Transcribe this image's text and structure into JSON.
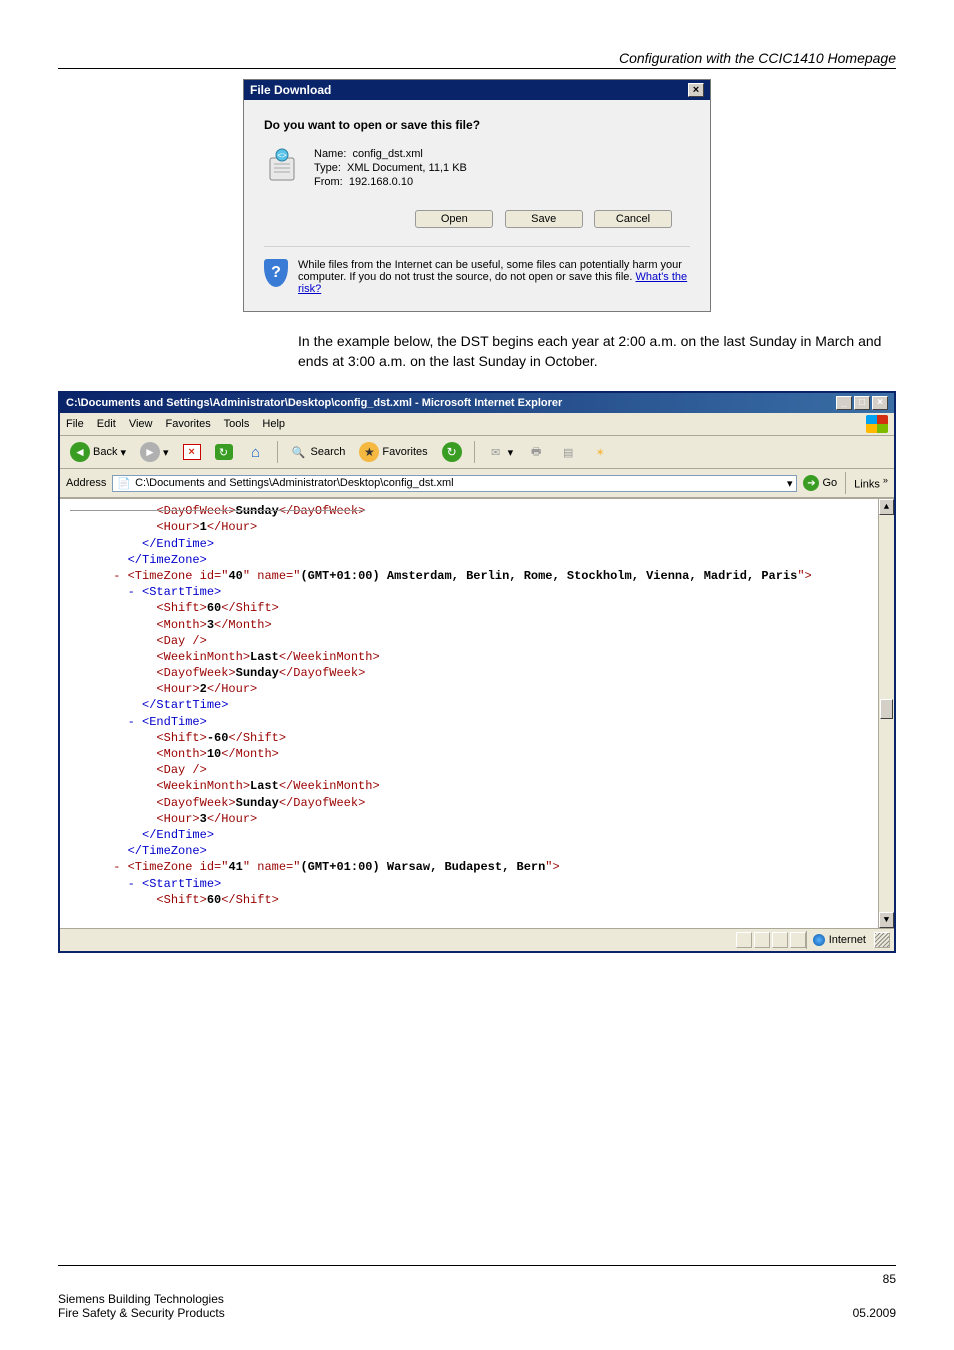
{
  "header": {
    "title": "Configuration with the CCIC1410 Homepage"
  },
  "dialog": {
    "title": "File Download",
    "question": "Do you want to open or save this file?",
    "name_label": "Name:",
    "name": "config_dst.xml",
    "type_label": "Type:",
    "type": "XML Document, 11,1 KB",
    "from_label": "From:",
    "from": "192.168.0.10",
    "buttons": {
      "open": "Open",
      "save": "Save",
      "cancel": "Cancel"
    },
    "warning": "While files from the Internet can be useful, some files can potentially harm your computer. If you do not trust the source, do not open or save this file. ",
    "warning_link": "What's the risk?"
  },
  "paragraph": "In the example below, the DST begins each year at 2:00 a.m. on the last Sunday in March and ends at 3:00 a.m. on the last Sunday in October.",
  "ie": {
    "title": "C:\\Documents and Settings\\Administrator\\Desktop\\config_dst.xml - Microsoft Internet Explorer",
    "menu": {
      "file": "File",
      "edit": "Edit",
      "view": "View",
      "favorites": "Favorites",
      "tools": "Tools",
      "help": "Help"
    },
    "toolbar": {
      "back": "Back",
      "search": "Search",
      "favorites": "Favorites"
    },
    "address_label": "Address",
    "address": "C:\\Documents and Settings\\Administrator\\Desktop\\config_dst.xml",
    "go": "Go",
    "links": "Links",
    "status_zone": "Internet"
  },
  "xml": {
    "l0a": "<DayOfWeek>",
    "l0b": "Sunday",
    "l0c": "</DayOfWeek>",
    "l1": "            <Hour>",
    "l1v": "1",
    "l1e": "</Hour>",
    "l2": "          </EndTime>",
    "l3": "        </TimeZone>",
    "l4a": "      - ",
    "l4b": "<TimeZone id=\"",
    "l4c": "40",
    "l4d": "\" name=\"",
    "l4e": "(GMT+01:00) Amsterdam, Berlin, Rome, Stockholm, Vienna, Madrid, Paris",
    "l4f": "\">",
    "l5": "        - <StartTime>",
    "l6": "            <Shift>",
    "l6v": "60",
    "l6e": "</Shift>",
    "l7": "            <Month>",
    "l7v": "3",
    "l7e": "</Month>",
    "l8": "            <Day />",
    "l9": "            <WeekinMonth>",
    "l9v": "Last",
    "l9e": "</WeekinMonth>",
    "l10": "            <DayofWeek>",
    "l10v": "Sunday",
    "l10e": "</DayofWeek>",
    "l11": "            <Hour>",
    "l11v": "2",
    "l11e": "</Hour>",
    "l12": "          </StartTime>",
    "l13": "        - <EndTime>",
    "l14": "            <Shift>",
    "l14v": "-60",
    "l14e": "</Shift>",
    "l15": "            <Month>",
    "l15v": "10",
    "l15e": "</Month>",
    "l16": "            <Day />",
    "l17": "            <WeekinMonth>",
    "l17v": "Last",
    "l17e": "</WeekinMonth>",
    "l18": "            <DayofWeek>",
    "l18v": "Sunday",
    "l18e": "</DayofWeek>",
    "l19": "            <Hour>",
    "l19v": "3",
    "l19e": "</Hour>",
    "l20": "          </EndTime>",
    "l21": "        </TimeZone>",
    "l22a": "      - ",
    "l22b": "<TimeZone id=\"",
    "l22c": "41",
    "l22d": "\" name=\"",
    "l22e": "(GMT+01:00) Warsaw, Budapest, Bern",
    "l22f": "\">",
    "l23": "        - <StartTime>",
    "l24": "            <Shift>",
    "l24v": "60",
    "l24e": "</Shift>"
  },
  "footer": {
    "page": "85",
    "left1": "Siemens Building Technologies",
    "left2": "Fire Safety & Security Products",
    "right": "05.2009"
  }
}
